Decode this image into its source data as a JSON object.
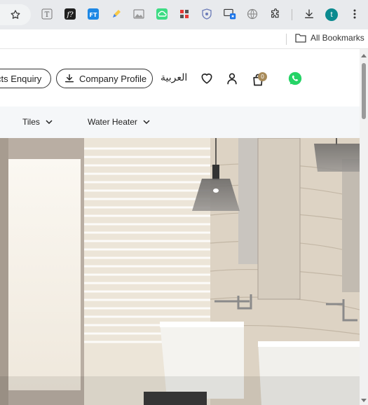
{
  "browser": {
    "toolbar_icons": [
      "bookmark-star-icon",
      "text-extension-icon",
      "formula-extension-icon",
      "ft-extension-icon",
      "highlighter-extension-icon",
      "image-extension-icon",
      "cloud-extension-icon",
      "puzzle-grid-extension-icon",
      "shield-extension-icon",
      "screen-share-extension-icon",
      "globe-extension-icon",
      "extensions-puzzle-icon",
      "download-icon",
      "profile-avatar-icon",
      "kebab-menu-icon"
    ],
    "profile_initial": "t",
    "all_bookmarks_label": "All Bookmarks"
  },
  "header": {
    "enquiry_label": "cts Enquiry",
    "company_profile_label": "Company Profile",
    "language_label": "العربية",
    "cart_count": "0"
  },
  "nav": {
    "items": [
      {
        "label": "Tiles"
      },
      {
        "label": "Water Heater"
      }
    ]
  },
  "colors": {
    "whatsapp": "#25D366",
    "badge": "#A88B5A",
    "profile": "#0B8A8F",
    "nav_bg": "#F5F7F9"
  }
}
